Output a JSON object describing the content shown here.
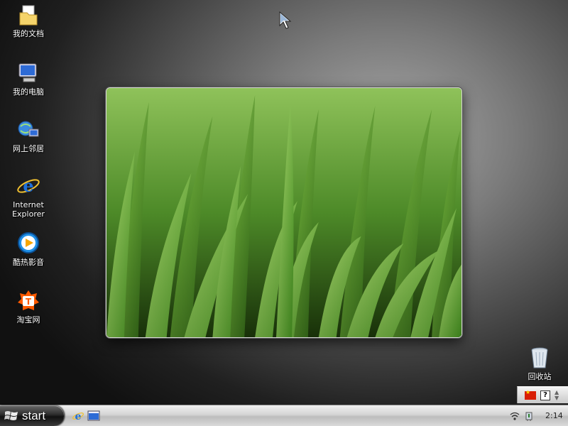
{
  "desktop": {
    "icons": [
      {
        "label": "我的文档",
        "icon": "my-documents-icon"
      },
      {
        "label": "我的电脑",
        "icon": "my-computer-icon"
      },
      {
        "label": "网上邻居",
        "icon": "network-places-icon"
      },
      {
        "label": "Internet\nExplorer",
        "icon": "internet-explorer-icon"
      },
      {
        "label": "酷热影音",
        "icon": "media-player-icon"
      },
      {
        "label": "淘宝网",
        "icon": "taobao-icon"
      },
      {
        "label": "回收站",
        "icon": "recycle-bin-icon"
      }
    ]
  },
  "taskbar": {
    "start_label": "start",
    "quick_launch": [
      "internet-explorer-icon",
      "show-desktop-icon"
    ],
    "tray": {
      "icons": [
        "wireless-network-icon",
        "safely-remove-hardware-icon"
      ],
      "clock": "2:14"
    }
  },
  "language_bar": {
    "icons": [
      "china-flag-icon",
      "help-icon"
    ],
    "help_glyph": "?"
  },
  "colors": {
    "taskbar_top": "#f0f0f0",
    "start_button": "#2c2c2c",
    "grass_green": "#5a9e2e"
  }
}
